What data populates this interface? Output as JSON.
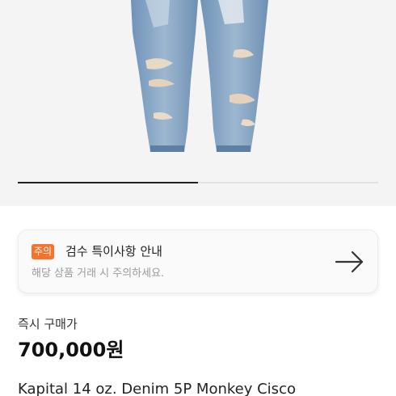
{
  "notice": {
    "badge": "주의",
    "title": "검수 특이사항 안내",
    "subtitle": "해당 상품 거래 시 주의하세요.",
    "arrow_icon": "arrow-right-icon"
  },
  "price": {
    "label": "즉시 구매가",
    "value": "700,000원"
  },
  "product": {
    "title": "Kapital 14 oz. Denim 5P Monkey Cisco"
  },
  "gallery": {
    "image": "distressed-jeans-photo",
    "current_page": 1,
    "total_pages": 2
  },
  "colors": {
    "badge": "#f3742d",
    "indicator_active": "#222222"
  }
}
